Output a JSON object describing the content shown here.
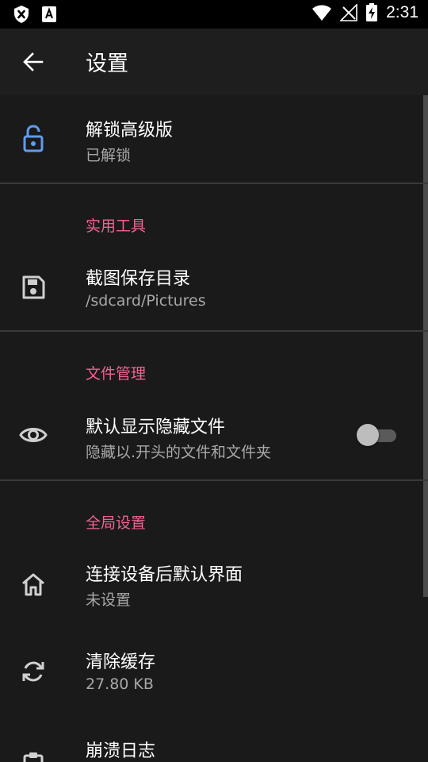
{
  "status_bar": {
    "time": "2:31"
  },
  "app_bar": {
    "title": "设置"
  },
  "unlock": {
    "title": "解锁高级版",
    "subtitle": "已解锁"
  },
  "tools": {
    "header": "实用工具",
    "screenshot_dir": {
      "title": "截图保存目录",
      "subtitle": "/sdcard/Pictures"
    }
  },
  "files": {
    "header": "文件管理",
    "show_hidden": {
      "title": "默认显示隐藏文件",
      "subtitle": "隐藏以.开头的文件和文件夹",
      "enabled": false
    }
  },
  "global": {
    "header": "全局设置",
    "default_view": {
      "title": "连接设备后默认界面",
      "subtitle": "未设置"
    },
    "clear_cache": {
      "title": "清除缓存",
      "subtitle": "27.80 KB"
    },
    "crash_log": {
      "title": "崩溃日志"
    }
  },
  "colors": {
    "accent": "#f06292",
    "icon_blue": "#5e9cf0",
    "background": "#1a1a1a"
  }
}
